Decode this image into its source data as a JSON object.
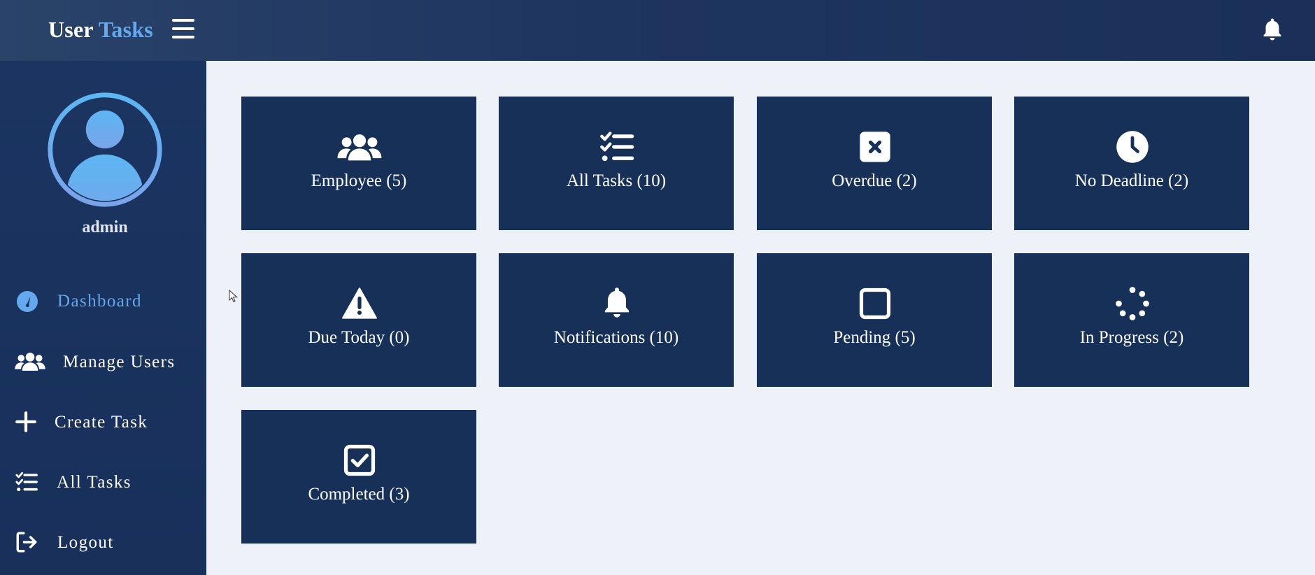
{
  "header": {
    "brand_part1": "User",
    "brand_part2": "Tasks",
    "menu_icon": "hamburger-icon",
    "notifications_icon": "bell-icon"
  },
  "sidebar": {
    "avatar_icon": "user-avatar-icon",
    "username": "admin",
    "items": [
      {
        "label": "Dashboard",
        "icon": "dashboard-icon",
        "active": true
      },
      {
        "label": "Manage Users",
        "icon": "users-icon",
        "active": false
      },
      {
        "label": "Create Task",
        "icon": "plus-icon",
        "active": false
      },
      {
        "label": "All Tasks",
        "icon": "task-list-icon",
        "active": false
      },
      {
        "label": "Logout",
        "icon": "logout-icon",
        "active": false
      }
    ]
  },
  "cards": [
    {
      "label": "Employee (5)",
      "icon": "users-icon"
    },
    {
      "label": "All Tasks (10)",
      "icon": "task-list-icon"
    },
    {
      "label": "Overdue (2)",
      "icon": "x-square-icon"
    },
    {
      "label": "No Deadline (2)",
      "icon": "clock-icon"
    },
    {
      "label": "Due Today (0)",
      "icon": "warning-icon"
    },
    {
      "label": "Notifications (10)",
      "icon": "bell-icon"
    },
    {
      "label": "Pending (5)",
      "icon": "square-icon"
    },
    {
      "label": "In Progress (2)",
      "icon": "spinner-icon"
    },
    {
      "label": "Completed (3)",
      "icon": "check-square-icon"
    }
  ],
  "colors": {
    "header_bg": "#1e3560",
    "sidebar_bg": "#1b3461",
    "card_bg": "#163058",
    "accent": "#64a9ee",
    "content_bg": "#eef2f8"
  }
}
